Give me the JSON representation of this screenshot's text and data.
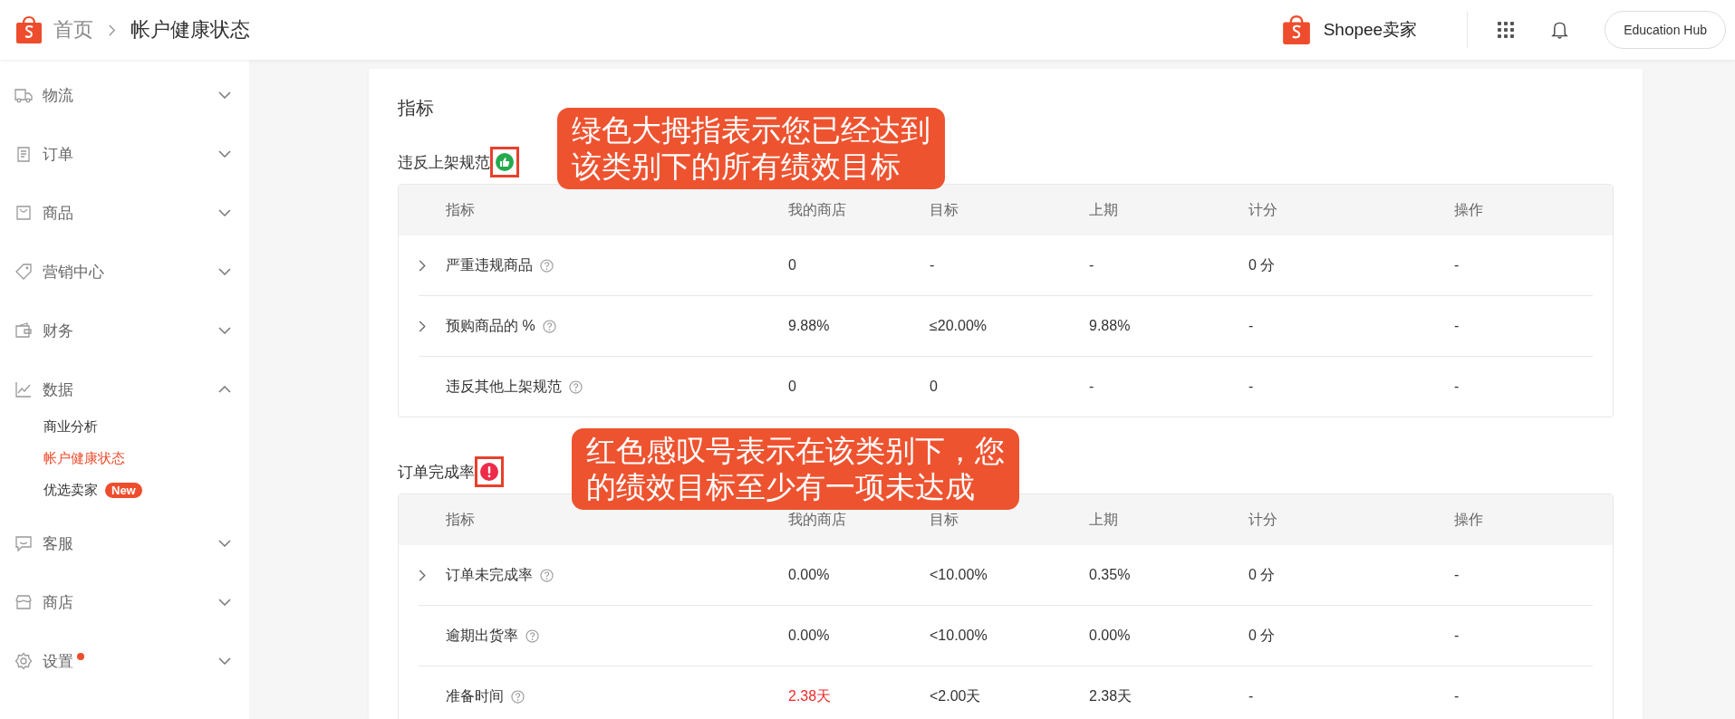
{
  "header": {
    "breadcrumb": [
      {
        "label": "首页",
        "current": false
      },
      {
        "label": "帐户健康状态",
        "current": true
      }
    ],
    "brand": "Shopee卖家",
    "button": "Education Hub"
  },
  "sidebar": {
    "items": [
      {
        "label": "物流",
        "expanded": false,
        "alert": false
      },
      {
        "label": "订单",
        "expanded": false,
        "alert": false
      },
      {
        "label": "商品",
        "expanded": false,
        "alert": false
      },
      {
        "label": "营销中心",
        "expanded": false,
        "alert": false
      },
      {
        "label": "财务",
        "expanded": false,
        "alert": false
      },
      {
        "label": "数据",
        "expanded": true,
        "alert": false,
        "children": [
          {
            "label": "商业分析",
            "selected": false
          },
          {
            "label": "帐户健康状态",
            "selected": true
          },
          {
            "label": "优选卖家",
            "selected": false,
            "badge": "New"
          }
        ]
      },
      {
        "label": "客服",
        "expanded": false,
        "alert": false
      },
      {
        "label": "商店",
        "expanded": false,
        "alert": false
      },
      {
        "label": "设置",
        "expanded": false,
        "alert": true
      }
    ]
  },
  "main": {
    "title": "指标",
    "sections": [
      {
        "title": "违反上架规范",
        "passed": true,
        "annotation": [
          "绿色大拇指表示您已经达到",
          "该类别下的所有绩效目标"
        ],
        "columns": [
          "指标",
          "我的商店",
          "目标",
          "上期",
          "计分",
          "操作"
        ],
        "rows": [
          {
            "expandable": true,
            "metric": "严重违规商品",
            "my_store": "0",
            "my_store_alert": false,
            "target": "-",
            "last_period": "-",
            "score": "0 分",
            "action": "-"
          },
          {
            "expandable": true,
            "metric": "预购商品的 %",
            "my_store": "9.88%",
            "my_store_alert": false,
            "target": "≤20.00%",
            "last_period": "9.88%",
            "score": "-",
            "action": "-"
          },
          {
            "expandable": false,
            "metric": "违反其他上架规范",
            "my_store": "0",
            "my_store_alert": false,
            "target": "0",
            "last_period": "-",
            "score": "-",
            "action": "-"
          }
        ]
      },
      {
        "title": "订单完成率",
        "passed": false,
        "annotation": [
          "红色感叹号表示在该类别下，您",
          "的绩效目标至少有一项未达成"
        ],
        "columns": [
          "指标",
          "我的商店",
          "目标",
          "上期",
          "计分",
          "操作"
        ],
        "rows": [
          {
            "expandable": true,
            "metric": "订单未完成率",
            "my_store": "0.00%",
            "my_store_alert": false,
            "target": "<10.00%",
            "last_period": "0.35%",
            "score": "0 分",
            "action": "-"
          },
          {
            "expandable": false,
            "metric": "逾期出货率",
            "my_store": "0.00%",
            "my_store_alert": false,
            "target": "<10.00%",
            "last_period": "0.00%",
            "score": "0 分",
            "action": "-"
          },
          {
            "expandable": false,
            "metric": "准备时间",
            "my_store": "2.38天",
            "my_store_alert": true,
            "target": "<2.00天",
            "last_period": "2.38天",
            "score": "-",
            "action": "-"
          }
        ]
      }
    ]
  }
}
